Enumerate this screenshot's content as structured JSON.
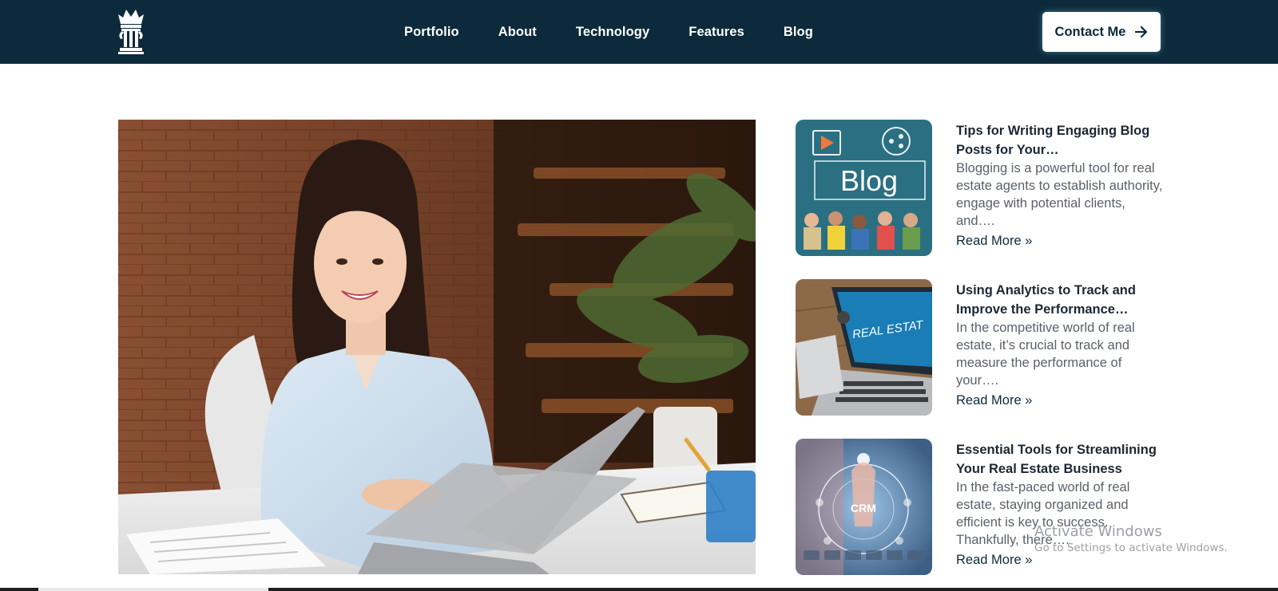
{
  "brand": {
    "logo_icon": "crown-pillar-logo-icon"
  },
  "nav": {
    "links": [
      "Portfolio",
      "About",
      "Technology",
      "Features",
      "Blog"
    ],
    "contact_label": "Contact Me",
    "contact_icon": "arrow-right-icon"
  },
  "hero": {
    "image": "woman-at-laptop-photo"
  },
  "posts": [
    {
      "title": "Tips for Writing Engaging Blog Posts for Your…",
      "excerpt": "Blogging is a powerful tool for real estate agents to establish authority, engage with potential clients, and….",
      "read_more": "Read More »",
      "thumb_text": "Blog"
    },
    {
      "title": "Using Analytics to Track and Improve the Performance…",
      "excerpt": "In the competitive world of real estate, it’s crucial to track and measure the performance of your….",
      "read_more": "Read More »",
      "thumb_text": "REAL ESTAT"
    },
    {
      "title": "Essential Tools for Streamlining Your Real Estate Business",
      "excerpt": "In the fast-paced world of real estate, staying organized and efficient is key to success. Thankfully, there….",
      "read_more": "Read More »",
      "thumb_text": "CRM"
    }
  ],
  "watermark": {
    "title": "Activate Windows",
    "subtitle": "Go to Settings to activate Windows."
  },
  "colors": {
    "nav_bg": "#0c2a3b",
    "accent": "#0c2a3b",
    "text": "#1c2733",
    "muted": "#5a6169"
  }
}
